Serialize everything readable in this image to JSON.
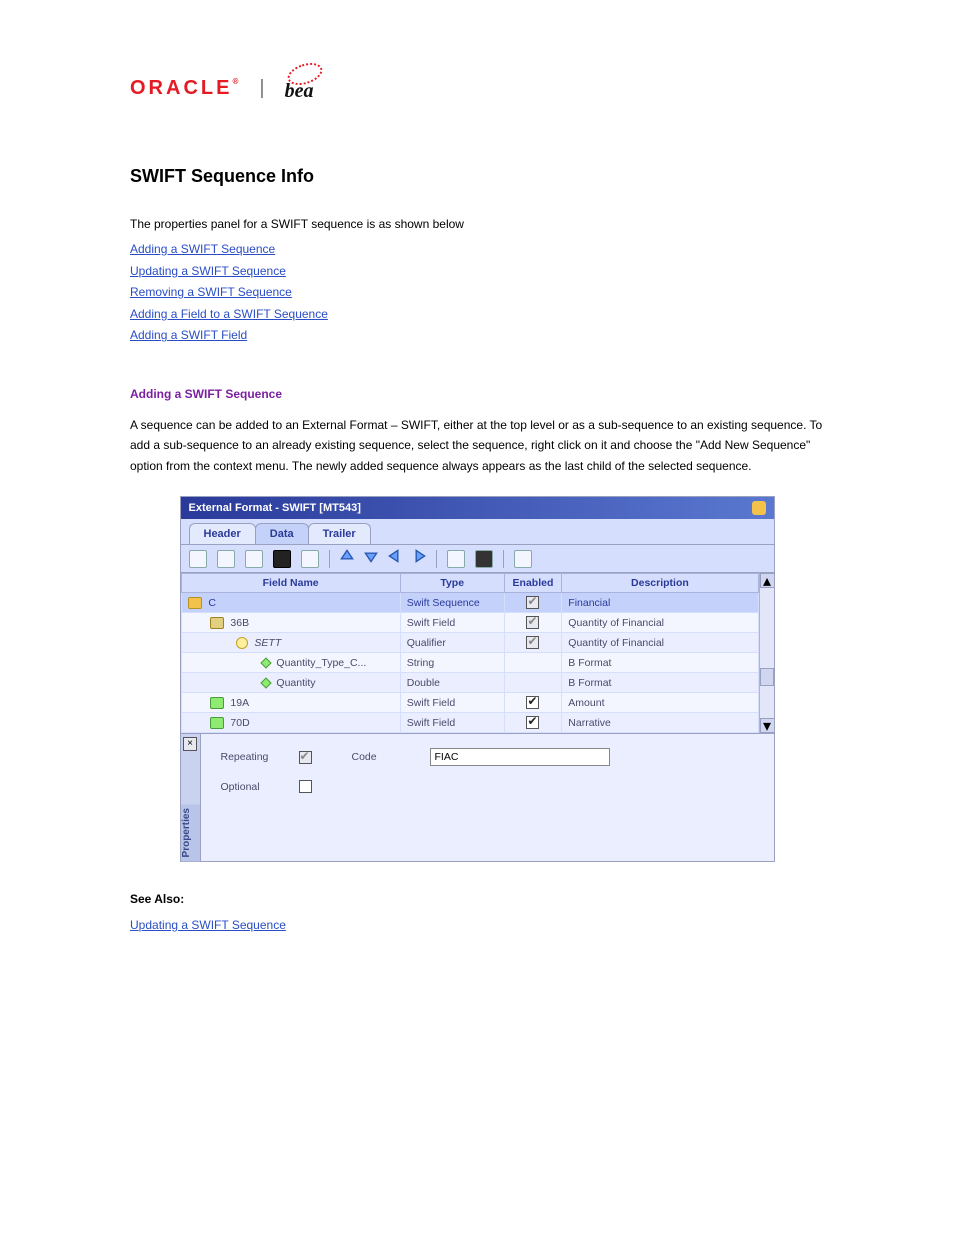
{
  "logos": {
    "oracle": "ORACLE",
    "bea": "bea"
  },
  "title": "SWIFT Sequence Info",
  "intro": "The properties panel for a SWIFT sequence is as shown below",
  "links": [
    "Adding a SWIFT Sequence",
    "Updating a SWIFT Sequence",
    "Removing a SWIFT Sequence",
    "Adding a Field to a SWIFT Sequence",
    "Adding a SWIFT Field"
  ],
  "subhead1": "Adding a SWIFT Sequence",
  "para1": "A sequence can be added to an External Format – SWIFT, either at the top level or as a sub-sequence to an existing sequence. To add a sub-sequence to an already existing sequence, select the sequence, right click on it and choose the \"Add New Sequence\" option from the context menu. The newly added sequence always appears as the last child of the selected sequence.",
  "seeAlsoHead": "See Also:",
  "seeAlsoLinks": [
    "Updating a SWIFT Sequence"
  ],
  "ef": {
    "windowTitle": "External Format - SWIFT [MT543]",
    "tabs": {
      "header": "Header",
      "data": "Data",
      "trailer": "Trailer"
    },
    "cols": {
      "fieldName": "Field Name",
      "type": "Type",
      "enabled": "Enabled",
      "description": "Description"
    },
    "rows": [
      {
        "name": "C",
        "type": "Swift Sequence",
        "enabled": "grey-ticked",
        "desc": "Financial",
        "icon": "folder",
        "indent": 0,
        "sel": true
      },
      {
        "name": "36B",
        "type": "Swift Field",
        "enabled": "grey-ticked",
        "desc": "Quantity of Financial",
        "icon": "envelope",
        "indent": 1
      },
      {
        "name": "SETT",
        "type": "Qualifier",
        "enabled": "grey-ticked",
        "desc": "Quantity of Financial",
        "icon": "qmark",
        "indent": 2,
        "italic": true
      },
      {
        "name": "Quantity_Type_C...",
        "type": "String",
        "enabled": "",
        "desc": "B Format",
        "icon": "diamond",
        "indent": 3
      },
      {
        "name": "Quantity",
        "type": "Double",
        "enabled": "",
        "desc": "B Format",
        "icon": "diamond",
        "indent": 3
      },
      {
        "name": "19A",
        "type": "Swift Field",
        "enabled": "ticked",
        "desc": "Amount",
        "icon": "green",
        "indent": 1
      },
      {
        "name": "70D",
        "type": "Swift Field",
        "enabled": "ticked",
        "desc": "Narrative",
        "icon": "green",
        "indent": 1
      }
    ],
    "props": {
      "panelLabel": "Properties",
      "repeating": "Repeating",
      "codeLabel": "Code",
      "codeValue": "FIAC",
      "optional": "Optional"
    }
  }
}
